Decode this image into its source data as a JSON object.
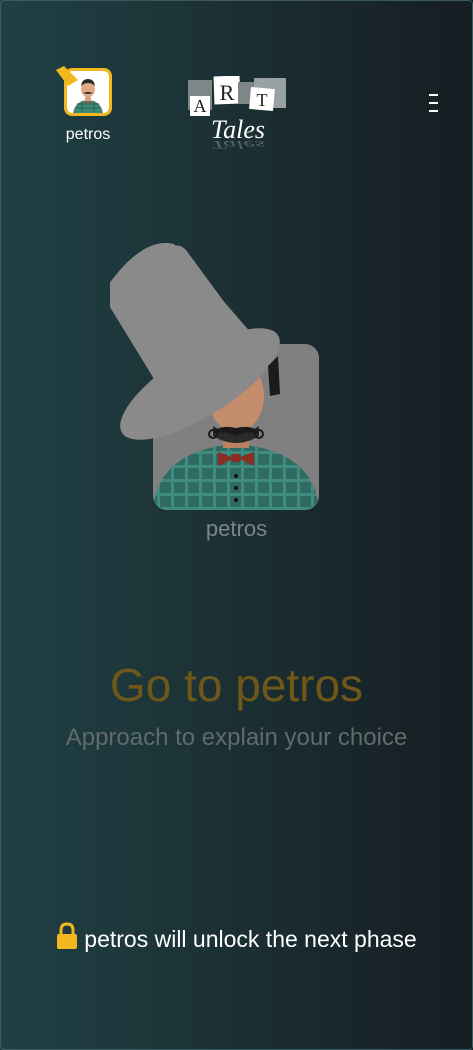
{
  "header": {
    "player": {
      "name": "petros"
    },
    "logo": {
      "letters": [
        "A",
        "R",
        "T"
      ],
      "word": "Tales"
    },
    "menu_icon": "kebab-menu-icon"
  },
  "main": {
    "target_name": "petros",
    "headline": "Go to petros",
    "hint": "Approach to explain your choice",
    "unlock_message": "petros will unlock the next phase",
    "lock_icon": "lock-icon"
  },
  "colors": {
    "accent_yellow": "#f2b81d",
    "headline": "#6e5718",
    "background_left": "#1f4045",
    "background_right": "#151d22"
  }
}
